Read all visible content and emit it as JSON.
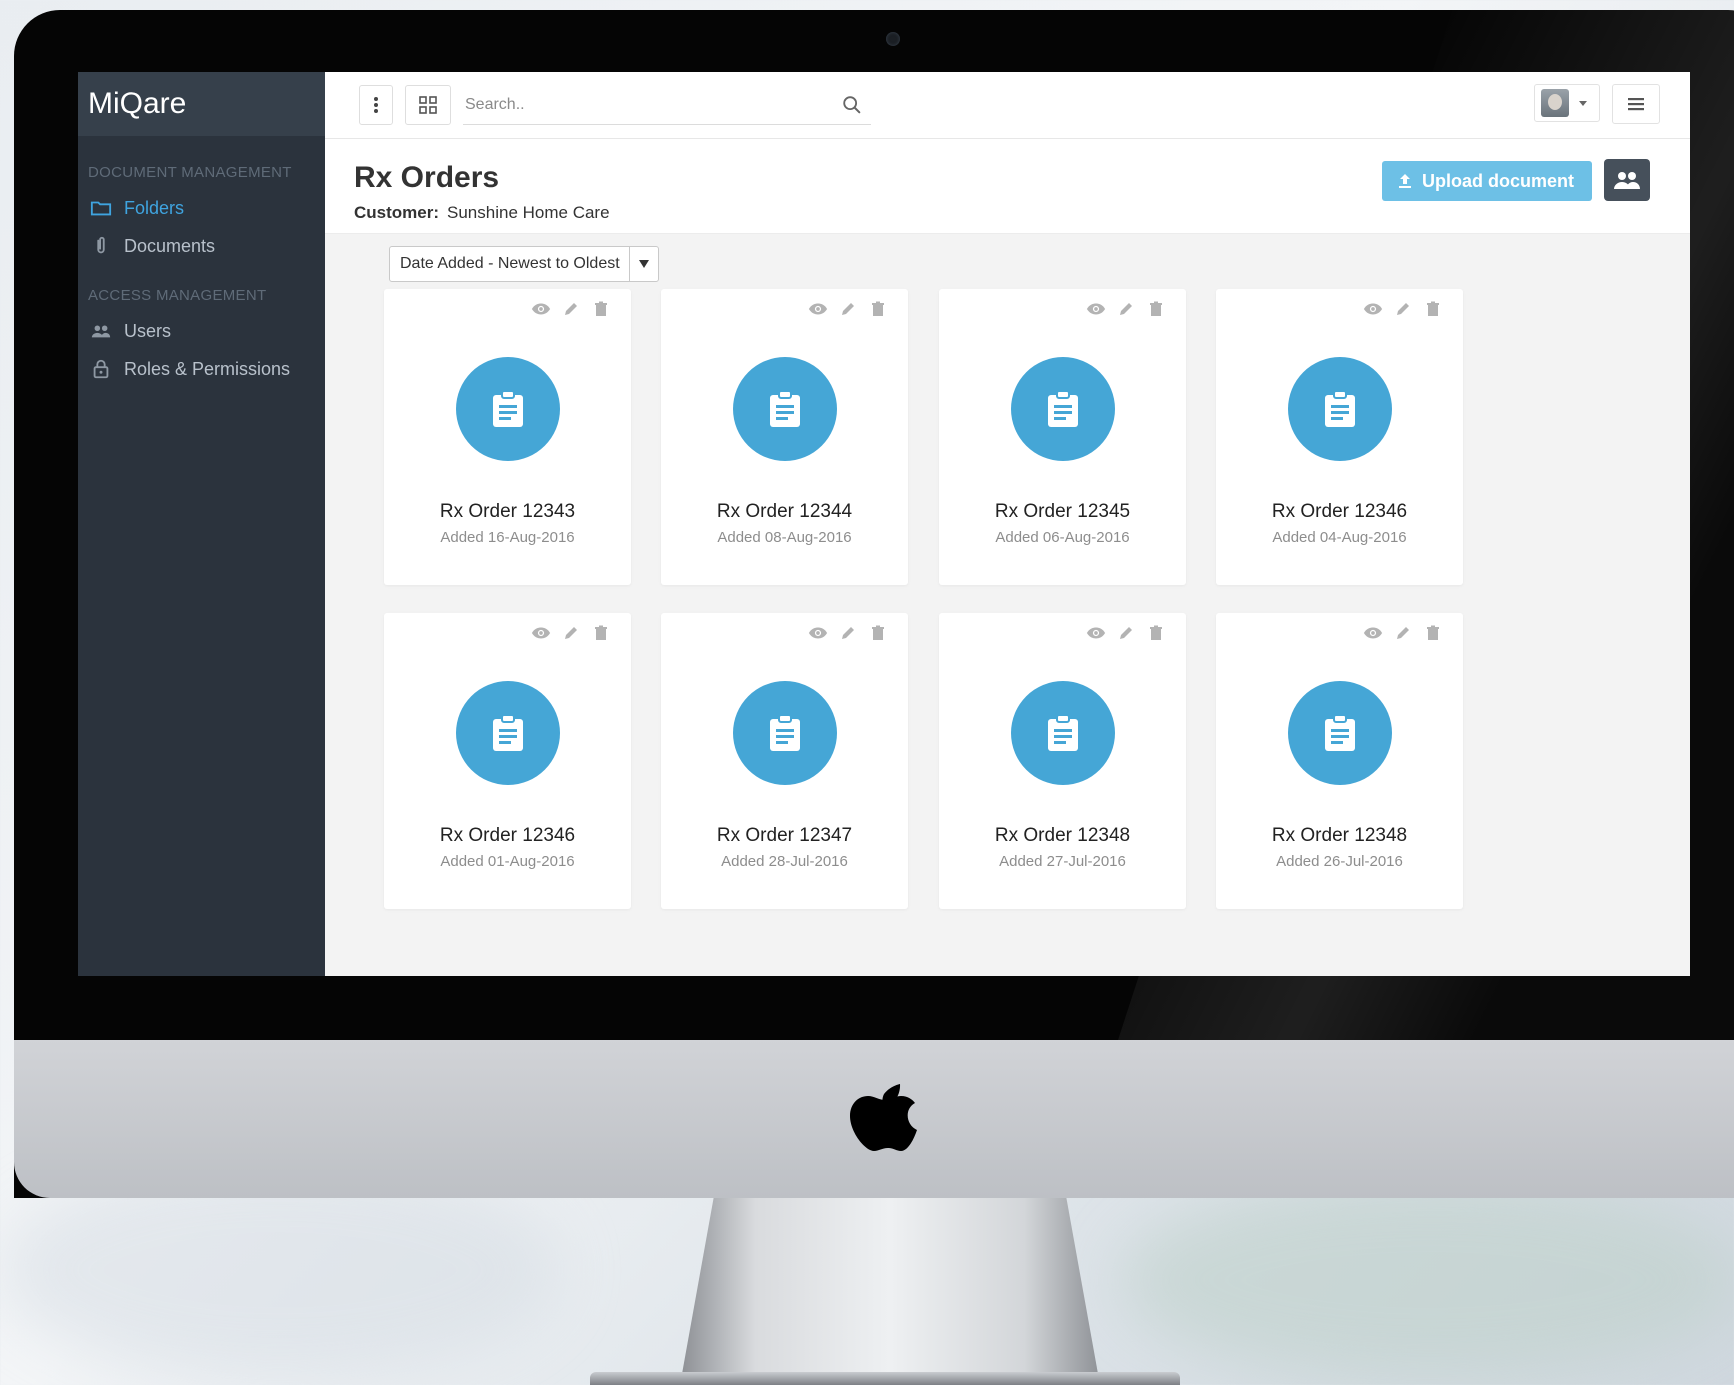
{
  "app": {
    "brand": "MiQare"
  },
  "sidebar": {
    "sections": [
      {
        "title": "DOCUMENT MANAGEMENT",
        "items": [
          {
            "label": "Folders",
            "icon": "folder-icon",
            "active": true
          },
          {
            "label": "Documents",
            "icon": "paperclip-icon",
            "active": false
          }
        ]
      },
      {
        "title": "ACCESS MANAGEMENT",
        "items": [
          {
            "label": "Users",
            "icon": "users-icon",
            "active": false
          },
          {
            "label": "Roles & Permissions",
            "icon": "lock-icon",
            "active": false
          }
        ]
      }
    ]
  },
  "topbar": {
    "search_placeholder": "Search..",
    "icons": [
      "kebab-menu-icon",
      "grid-view-icon",
      "search-icon",
      "avatar",
      "chevron-down-icon",
      "list-menu-icon"
    ]
  },
  "header": {
    "title": "Rx Orders",
    "customer_label": "Customer:",
    "customer_name": "Sunshine Home Care",
    "upload_label": "Upload document"
  },
  "sort": {
    "selected": "Date Added - Newest to Oldest"
  },
  "cards": [
    {
      "name": "Rx Order 12343",
      "added": "Added 16-Aug-2016"
    },
    {
      "name": "Rx Order 12344",
      "added": "Added 08-Aug-2016"
    },
    {
      "name": "Rx Order 12345",
      "added": "Added 06-Aug-2016"
    },
    {
      "name": "Rx Order 12346",
      "added": "Added 04-Aug-2016"
    },
    {
      "name": "Rx Order 12346",
      "added": "Added 01-Aug-2016"
    },
    {
      "name": "Rx Order 12347",
      "added": "Added 28-Jul-2016"
    },
    {
      "name": "Rx Order 12348",
      "added": "Added 27-Jul-2016"
    },
    {
      "name": "Rx Order 12348",
      "added": "Added 26-Jul-2016"
    }
  ],
  "colors": {
    "sidebar_bg": "#2b333d",
    "brand_bg": "#36404b",
    "accent": "#3fa4e0",
    "doc_circle": "#45a6d6",
    "upload_button": "#6dc0e6",
    "people_button": "#46505b"
  }
}
